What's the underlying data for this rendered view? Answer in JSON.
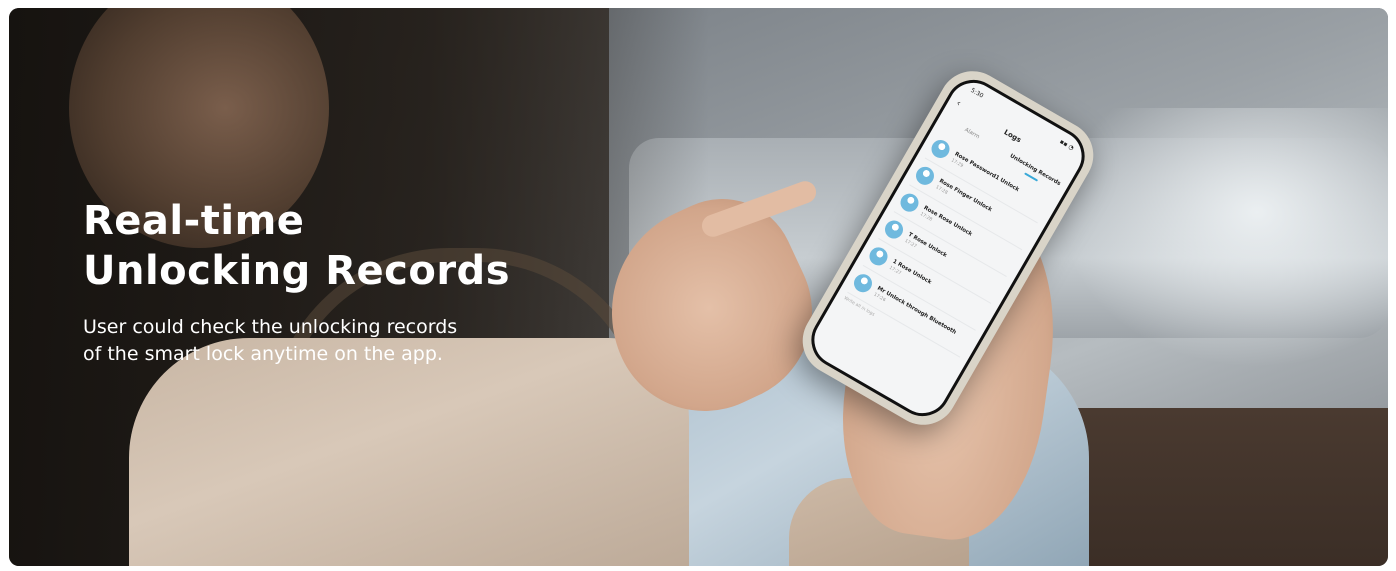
{
  "headline": {
    "line1": "Real-time",
    "line2": "Unlocking Records"
  },
  "description": {
    "line1": "User could check the unlocking records",
    "line2": "of the smart lock anytime on the app."
  },
  "phone_app": {
    "status_time": "5:30",
    "status_icons": "▪▪ ◔",
    "title": "Logs",
    "tabs": [
      "Alarm",
      "Unlocking Records"
    ],
    "active_tab": "Unlocking Records",
    "records": [
      {
        "title": "Rose Password1 Unlock",
        "time": "17:29"
      },
      {
        "title": "Rose Finger Unlock",
        "time": "17:28"
      },
      {
        "title": "Rose Rose Unlock",
        "time": "17:28"
      },
      {
        "title": "T Rose Unlock",
        "time": "17:27"
      },
      {
        "title": "1 Rose Unlock",
        "time": "17:27"
      },
      {
        "title": "Mr Unlock through Bluetooth",
        "time": "17:26"
      }
    ],
    "footer": "Write all in logs"
  },
  "colors": {
    "headline_text": "#ffffff",
    "tab_indicator": "#3aa9d8",
    "avatar": "#6fb9de"
  }
}
